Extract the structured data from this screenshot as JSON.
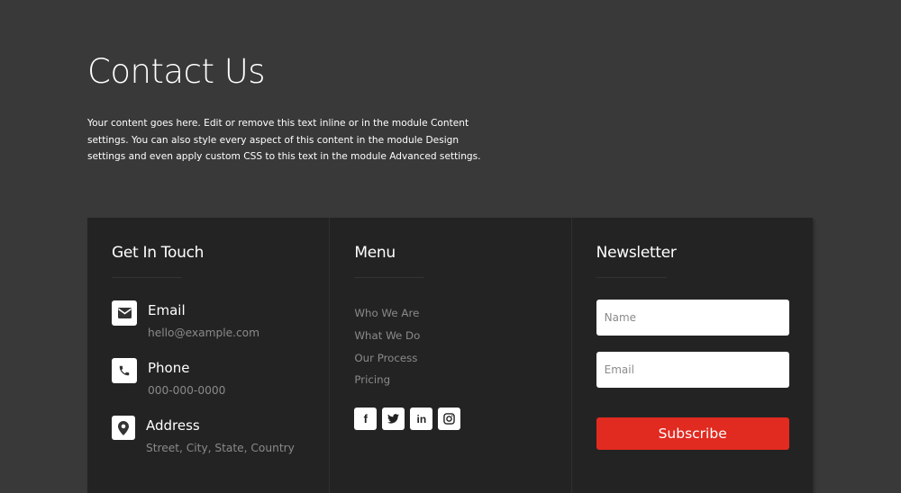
{
  "hero": {
    "title": "Contact Us",
    "body": "Your content goes here. Edit or remove this text inline or in the module Content settings. You can also style every aspect of this content in the module Design settings and even apply custom CSS to this text in the module Advanced settings."
  },
  "get_in_touch": {
    "title": "Get In Touch",
    "items": [
      {
        "icon": "envelope-icon",
        "label": "Email",
        "value": "hello@example.com"
      },
      {
        "icon": "phone-icon",
        "label": "Phone",
        "value": "000-000-0000"
      },
      {
        "icon": "map-pin-icon",
        "label": "Address",
        "value": "Street, City, State, Country"
      }
    ]
  },
  "menu": {
    "title": "Menu",
    "items": [
      "Who We Are",
      "What We Do",
      "Our Process",
      "Pricing"
    ],
    "socials": [
      {
        "icon": "facebook-icon",
        "glyph": "f"
      },
      {
        "icon": "twitter-icon",
        "glyph": ""
      },
      {
        "icon": "linkedin-icon",
        "glyph": "in"
      },
      {
        "icon": "instagram-icon",
        "glyph": ""
      }
    ]
  },
  "newsletter": {
    "title": "Newsletter",
    "name_placeholder": "Name",
    "name_value": "",
    "email_placeholder": "Email",
    "email_value": "",
    "button_label": "Subscribe",
    "button_color": "#e12a20"
  },
  "colors": {
    "page_bg": "#393939",
    "panel_bg": "#232323",
    "muted_text": "#8a8a8a"
  }
}
